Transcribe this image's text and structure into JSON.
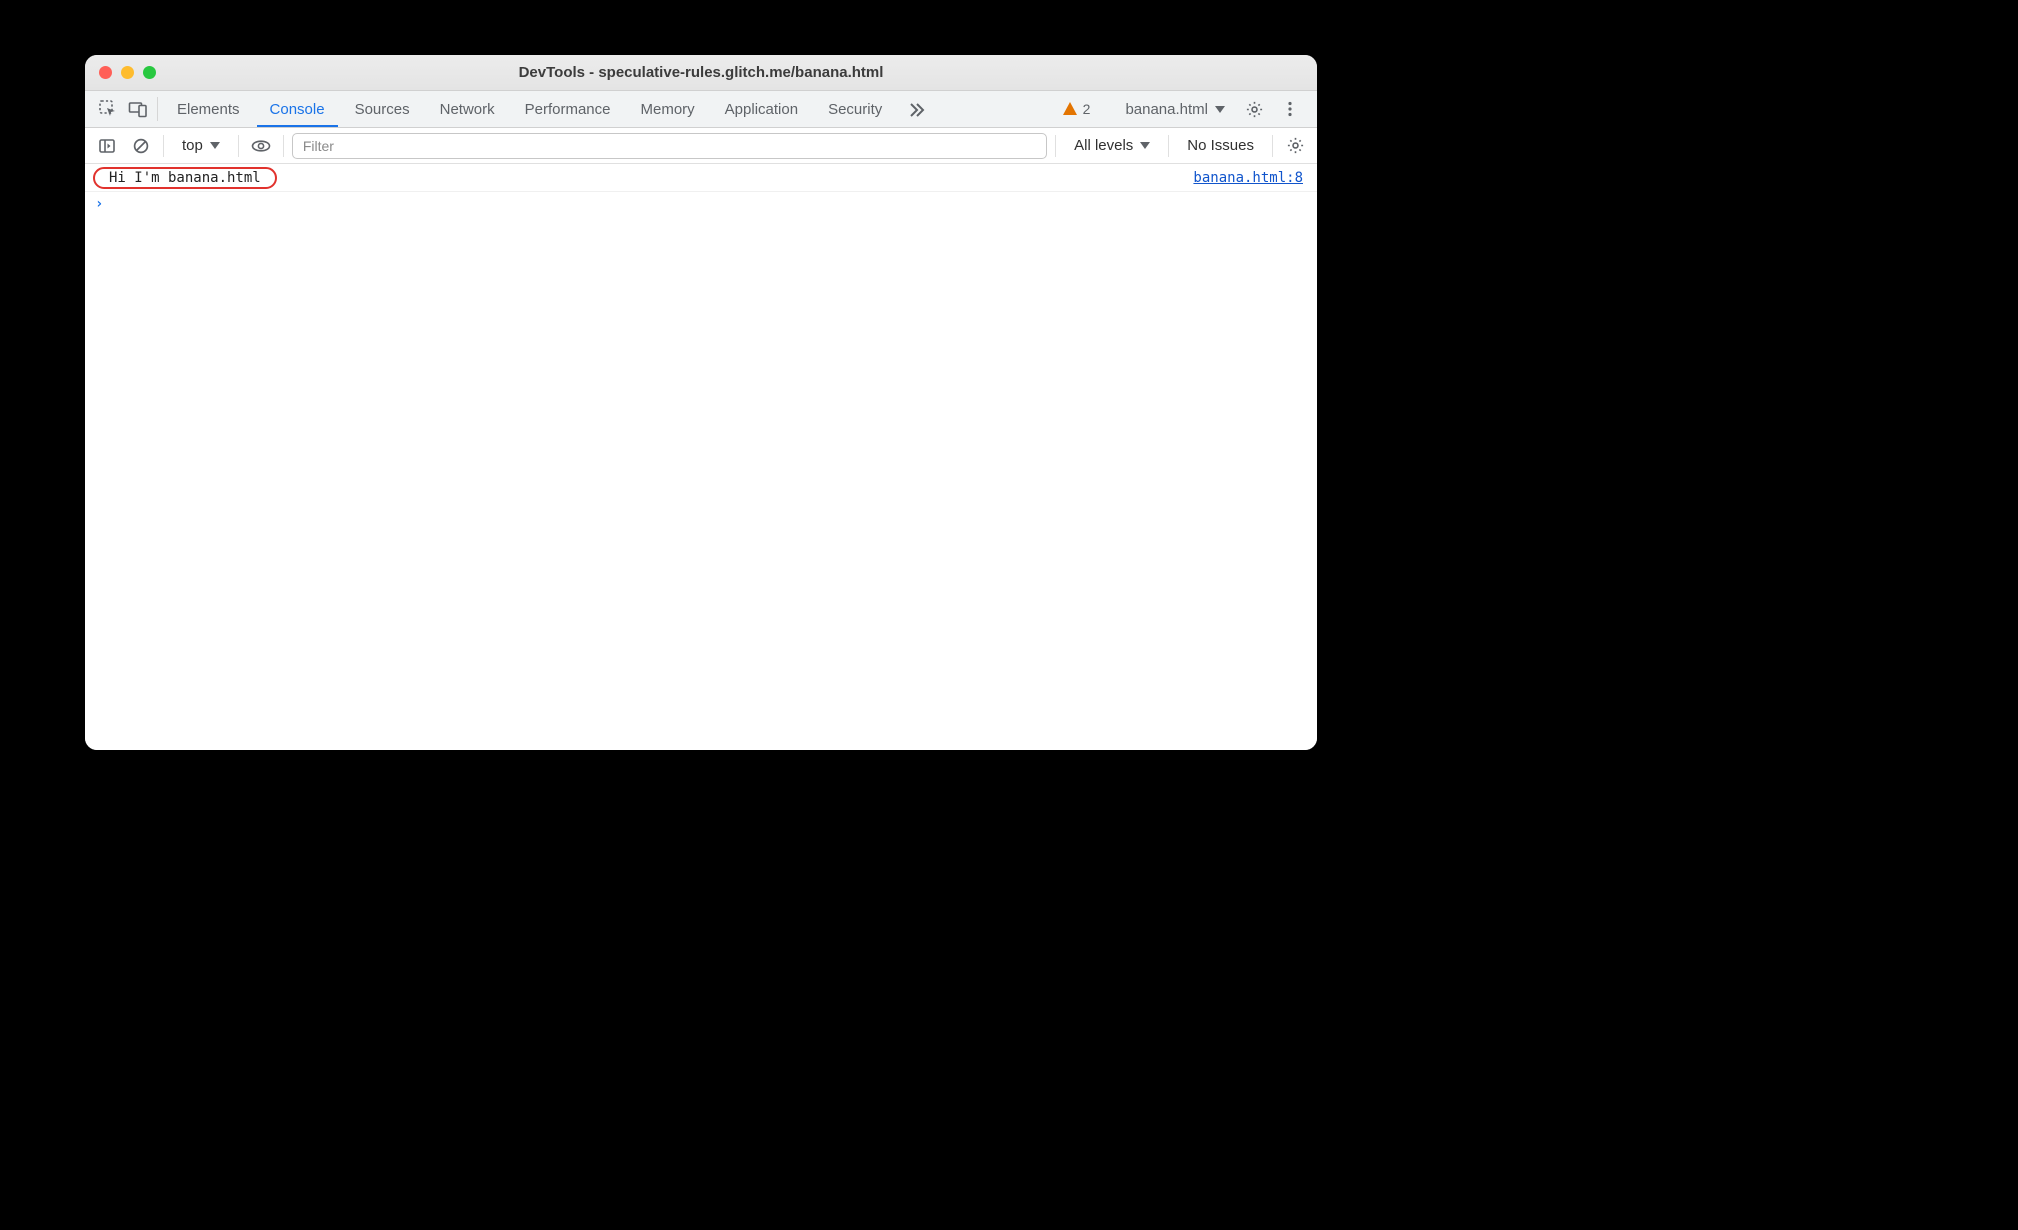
{
  "window": {
    "title": "DevTools - speculative-rules.glitch.me/banana.html"
  },
  "tabs": {
    "items": [
      "Elements",
      "Console",
      "Sources",
      "Network",
      "Performance",
      "Memory",
      "Application",
      "Security"
    ],
    "active_index": 1
  },
  "warnings": {
    "count": "2"
  },
  "target": {
    "label": "banana.html"
  },
  "subbar": {
    "context": "top",
    "filter_placeholder": "Filter",
    "levels_label": "All levels",
    "issues_label": "No Issues"
  },
  "console": {
    "rows": [
      {
        "message": "Hi I'm banana.html",
        "source": "banana.html:8",
        "highlighted": true
      }
    ]
  }
}
